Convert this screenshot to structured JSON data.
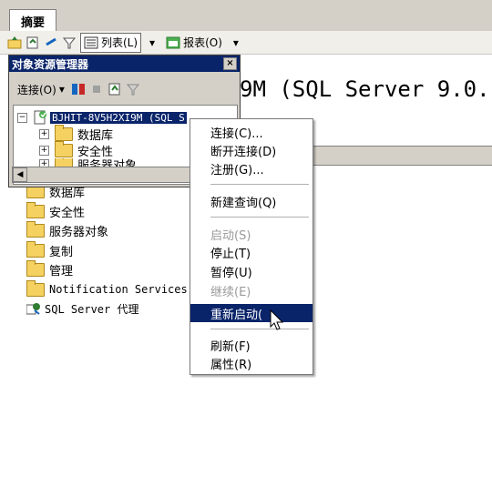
{
  "tabs": {
    "summary": "摘要"
  },
  "summary_toolbar": {
    "list_label": "列表(L)",
    "report_label": "报表(O)"
  },
  "summary": {
    "title_fragment": "9M (SQL Server 9.0.",
    "items": [
      {
        "label": "数据库",
        "icon": "folder-icon"
      },
      {
        "label": "安全性",
        "icon": "folder-icon"
      },
      {
        "label": "服务器对象",
        "icon": "folder-icon"
      },
      {
        "label": "复制",
        "icon": "folder-icon"
      },
      {
        "label": "管理",
        "icon": "folder-icon"
      },
      {
        "label": "Notification Services",
        "icon": "folder-icon"
      },
      {
        "label": "SQL Server 代理",
        "icon": "sql-agent-icon"
      }
    ]
  },
  "object_explorer": {
    "title": "对象资源管理器",
    "close_glyph": "×",
    "connect_label": "连接(O)",
    "tree": {
      "server": {
        "expander": "−",
        "label": "BJHIT-8V5H2XI9M (SQL S"
      },
      "children": [
        {
          "expander": "+",
          "label": "数据库"
        },
        {
          "expander": "+",
          "label": "安全性"
        },
        {
          "expander": "+",
          "label": "服务器对象"
        }
      ]
    },
    "scroll_left_glyph": "◀",
    "scroll_right_glyph": "▶"
  },
  "context_menu": {
    "items": [
      {
        "label": "连接(C)...",
        "state": "enabled"
      },
      {
        "label": "断开连接(D)",
        "state": "enabled"
      },
      {
        "label": "注册(G)...",
        "state": "enabled"
      },
      {
        "label": "新建查询(Q)",
        "state": "enabled"
      },
      {
        "label": "启动(S)",
        "state": "disabled"
      },
      {
        "label": "停止(T)",
        "state": "enabled"
      },
      {
        "label": "暂停(U)",
        "state": "enabled"
      },
      {
        "label": "继续(E)",
        "state": "disabled"
      },
      {
        "label": "重新启动(",
        "state": "selected"
      },
      {
        "label": "刷新(F)",
        "state": "enabled"
      },
      {
        "label": "属性(R)",
        "state": "enabled"
      }
    ]
  },
  "colors": {
    "highlight": "#0a246a",
    "chrome": "#d4d0c8",
    "folder": "#f4d160",
    "disabled_text": "#9a9a9a"
  }
}
